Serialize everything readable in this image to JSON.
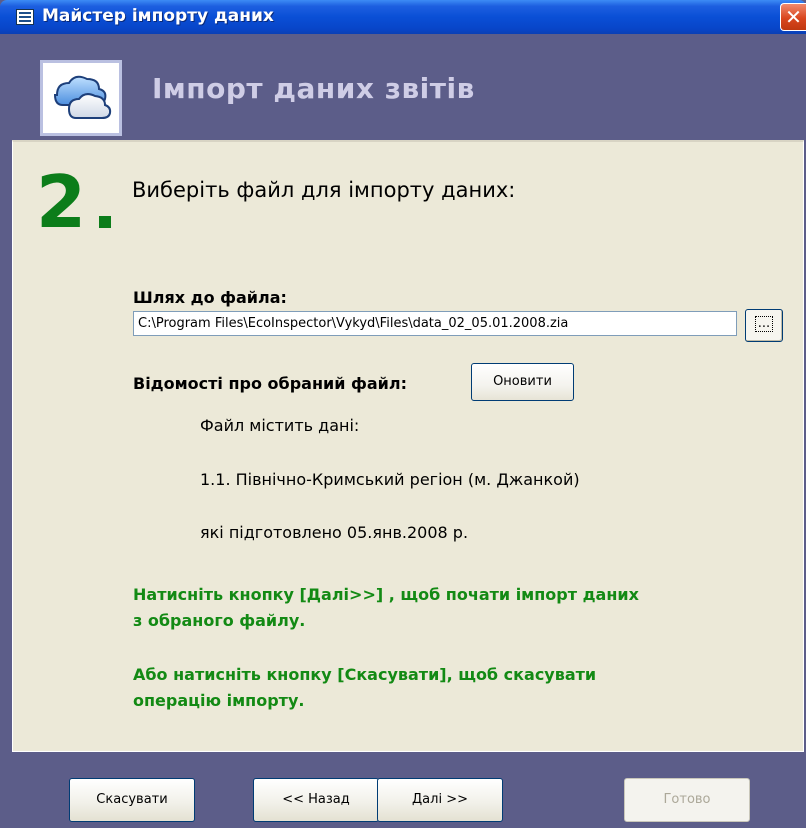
{
  "window": {
    "title": "Майстер імпорту даних",
    "close_glyph": "✕"
  },
  "header": {
    "title": "Імпорт даних звітів",
    "logo_icon": "cloud-icon"
  },
  "step": {
    "number": "2",
    "heading": "Виберіть файл для імпорту даних:"
  },
  "path": {
    "label": "Шлях до файла:",
    "value": "C:\\Program Files\\EcoInspector\\Vykyd\\Files\\data_02_05.01.2008.zia",
    "browse_label": "..."
  },
  "info": {
    "label": "Відомості про обраний файл:",
    "refresh_label": "Оновити",
    "line1": "Файл містить дані:",
    "line2": "1.1. Північно-Кримський регіон (м. Джанкой)",
    "line3": "які підготовлено 05.янв.2008 р."
  },
  "notes": {
    "next_line1": "Натисніть кнопку [Далі>>] , щоб почати імпорт даних",
    "next_line2": "з обраного файлу.",
    "cancel_line1": "Або натисніть кнопку [Скасувати], щоб скасувати",
    "cancel_line2": "операцію імпорту."
  },
  "footer": {
    "cancel_label": "Скасувати",
    "back_label": "<< Назад",
    "next_label": "Далі >>",
    "finish_label": "Готово"
  },
  "colors": {
    "title_bar": "#0a4fd6",
    "header_band": "#5c5d89",
    "panel": "#ece9d8",
    "step_green": "#0c7d1a",
    "note_green": "#138a14"
  }
}
